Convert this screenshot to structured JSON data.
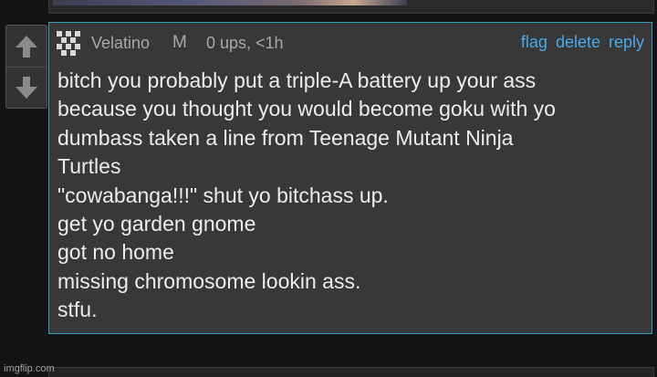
{
  "comment": {
    "author": "Velatino",
    "mod_badge": "M",
    "meta": "0 ups, <1h",
    "actions": {
      "flag": "flag",
      "delete": "delete",
      "reply": "reply"
    },
    "body_lines": [
      "bitch you probably put a triple-A battery up your ass",
      "because you thought you would become goku with yo",
      "dumbass taken a line from Teenage Mutant Ninja",
      "Turtles",
      "\"cowabanga!!!\" shut yo bitchass up.",
      "get yo garden gnome",
      "got no home",
      "missing chromosome lookin ass.",
      "stfu."
    ]
  },
  "vote": {
    "up_icon": "arrow-up-icon",
    "down_icon": "arrow-down-icon"
  },
  "watermark": "imgflip.com",
  "colors": {
    "background": "#141414",
    "comment_bg": "#383838",
    "comment_border": "#2f9fb5",
    "link": "#4aa8e6",
    "meta_text": "#a8a8a8",
    "body_text": "#ececec"
  }
}
